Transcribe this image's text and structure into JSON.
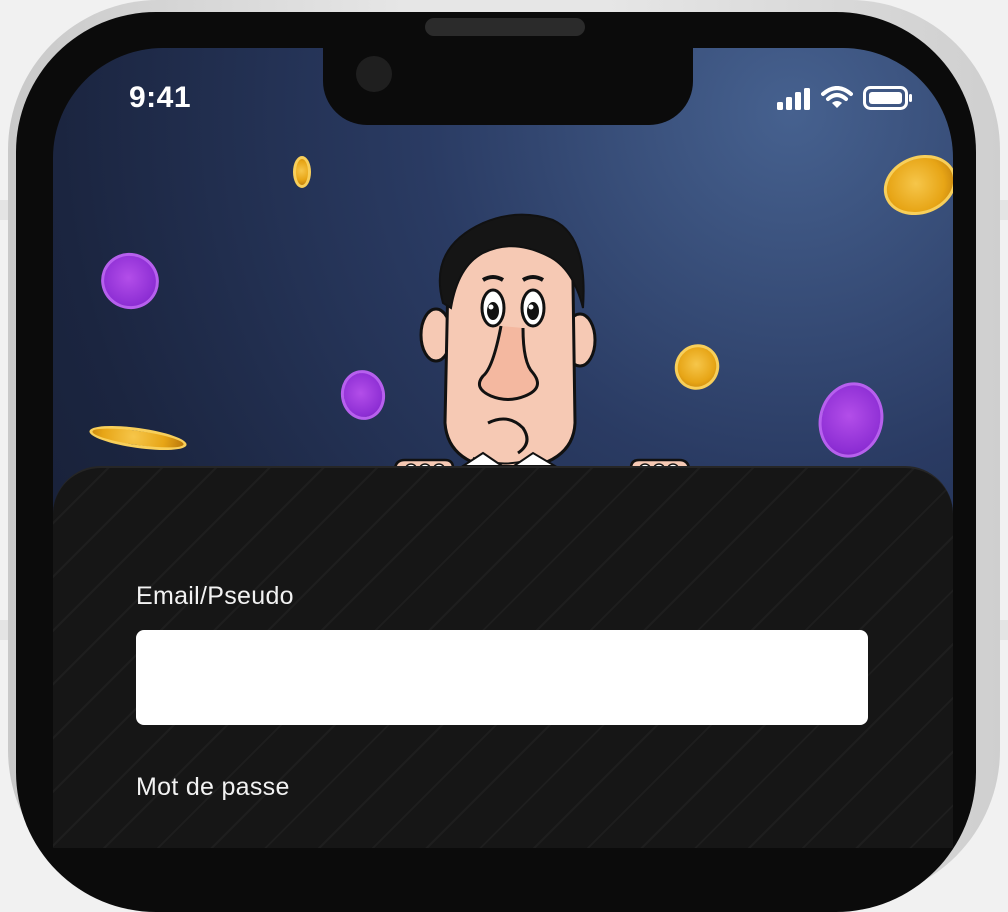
{
  "status_bar": {
    "time": "9:41",
    "icons": [
      "cellular-signal-icon",
      "wifi-icon",
      "battery-icon"
    ]
  },
  "illustration": {
    "character": "cartoon-man-peeking",
    "coins": [
      "gold-coin-icon",
      "purple-coin-icon"
    ]
  },
  "login_form": {
    "email_label": "Email/Pseudo",
    "email_value": "",
    "password_label": "Mot de passe"
  },
  "colors": {
    "background_top": "#2a3b63",
    "sheet": "#161616",
    "gold_coin": "#e7a516",
    "purple_coin": "#8d2ed4",
    "text": "#f2f2f2",
    "input_bg": "#ffffff"
  }
}
